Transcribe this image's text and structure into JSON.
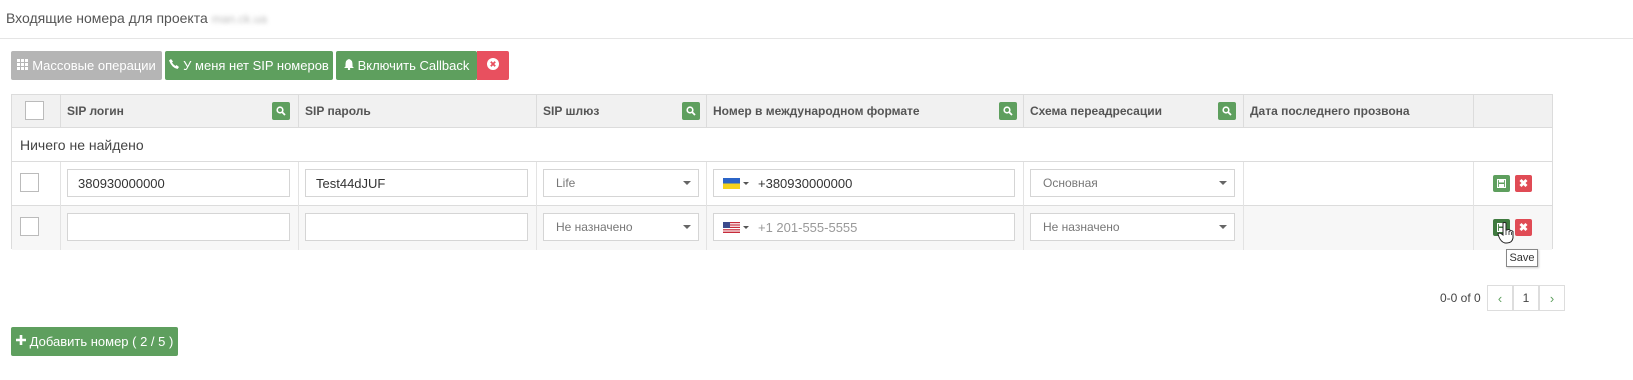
{
  "header": {
    "title": "Входящие номера для проекта",
    "project_name": "man.ck.ua"
  },
  "toolbar": {
    "bulk_label": "Массовые операции",
    "no_sip_label": "У меня нет SIP номеров",
    "callback_label": "Включить Callback"
  },
  "table": {
    "columns": [
      "SIP логин",
      "SIP пароль",
      "SIP шлюз",
      "Номер в международном формате",
      "Схема переадресации",
      "Дата последнего прозвона"
    ],
    "empty_text": "Ничего не найдено",
    "rows": [
      {
        "sip_login": "380930000000",
        "sip_password": "Test44dJUF",
        "gateway": "Life",
        "country": "UA",
        "phone": "+380930000000",
        "scheme": "Основная",
        "last_call": ""
      },
      {
        "sip_login": "",
        "sip_password": "",
        "gateway": "Не назначено",
        "country": "US",
        "phone_placeholder": "+1 201-555-5555",
        "scheme": "Не назначено",
        "last_call": ""
      }
    ]
  },
  "tooltip": "Save",
  "pagination": {
    "info": "0-0 of 0",
    "prev": "‹",
    "page": "1",
    "next": "›"
  },
  "add_button": {
    "label": "Добавить номер ( 2 / 5 )"
  },
  "colors": {
    "green": "#5e9f5e",
    "red": "#e8505f",
    "gray": "#b5b5b5"
  }
}
